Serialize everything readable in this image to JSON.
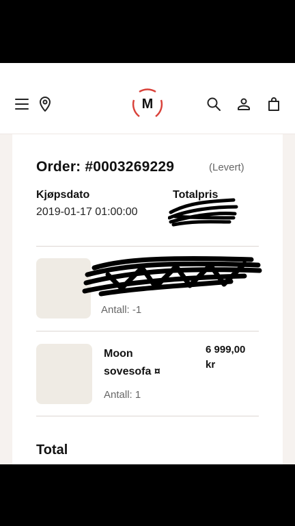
{
  "header": {
    "menu_icon": "hamburger-menu-icon",
    "location_icon": "map-pin-icon",
    "logo_letter": "M",
    "search_icon": "search-icon",
    "account_icon": "user-icon",
    "cart_icon": "shopping-bag-icon",
    "brand_color": "#d9423a"
  },
  "order": {
    "title": "Order: #0003269229",
    "status": "(Levert)",
    "purchase_date_label": "Kjøpsdato",
    "purchase_date_value": "2019-01-17 01:00:00",
    "total_price_label": "Totalpris"
  },
  "items": [
    {
      "name": "",
      "quantity_text": "Antall: -1"
    },
    {
      "name_line1": "Moon",
      "name_line2": "sovesofa ¤",
      "price_line1": "6 999,00",
      "price_line2": "kr",
      "quantity_text": "Antall: 1"
    }
  ],
  "summary": {
    "total_label": "Total"
  }
}
